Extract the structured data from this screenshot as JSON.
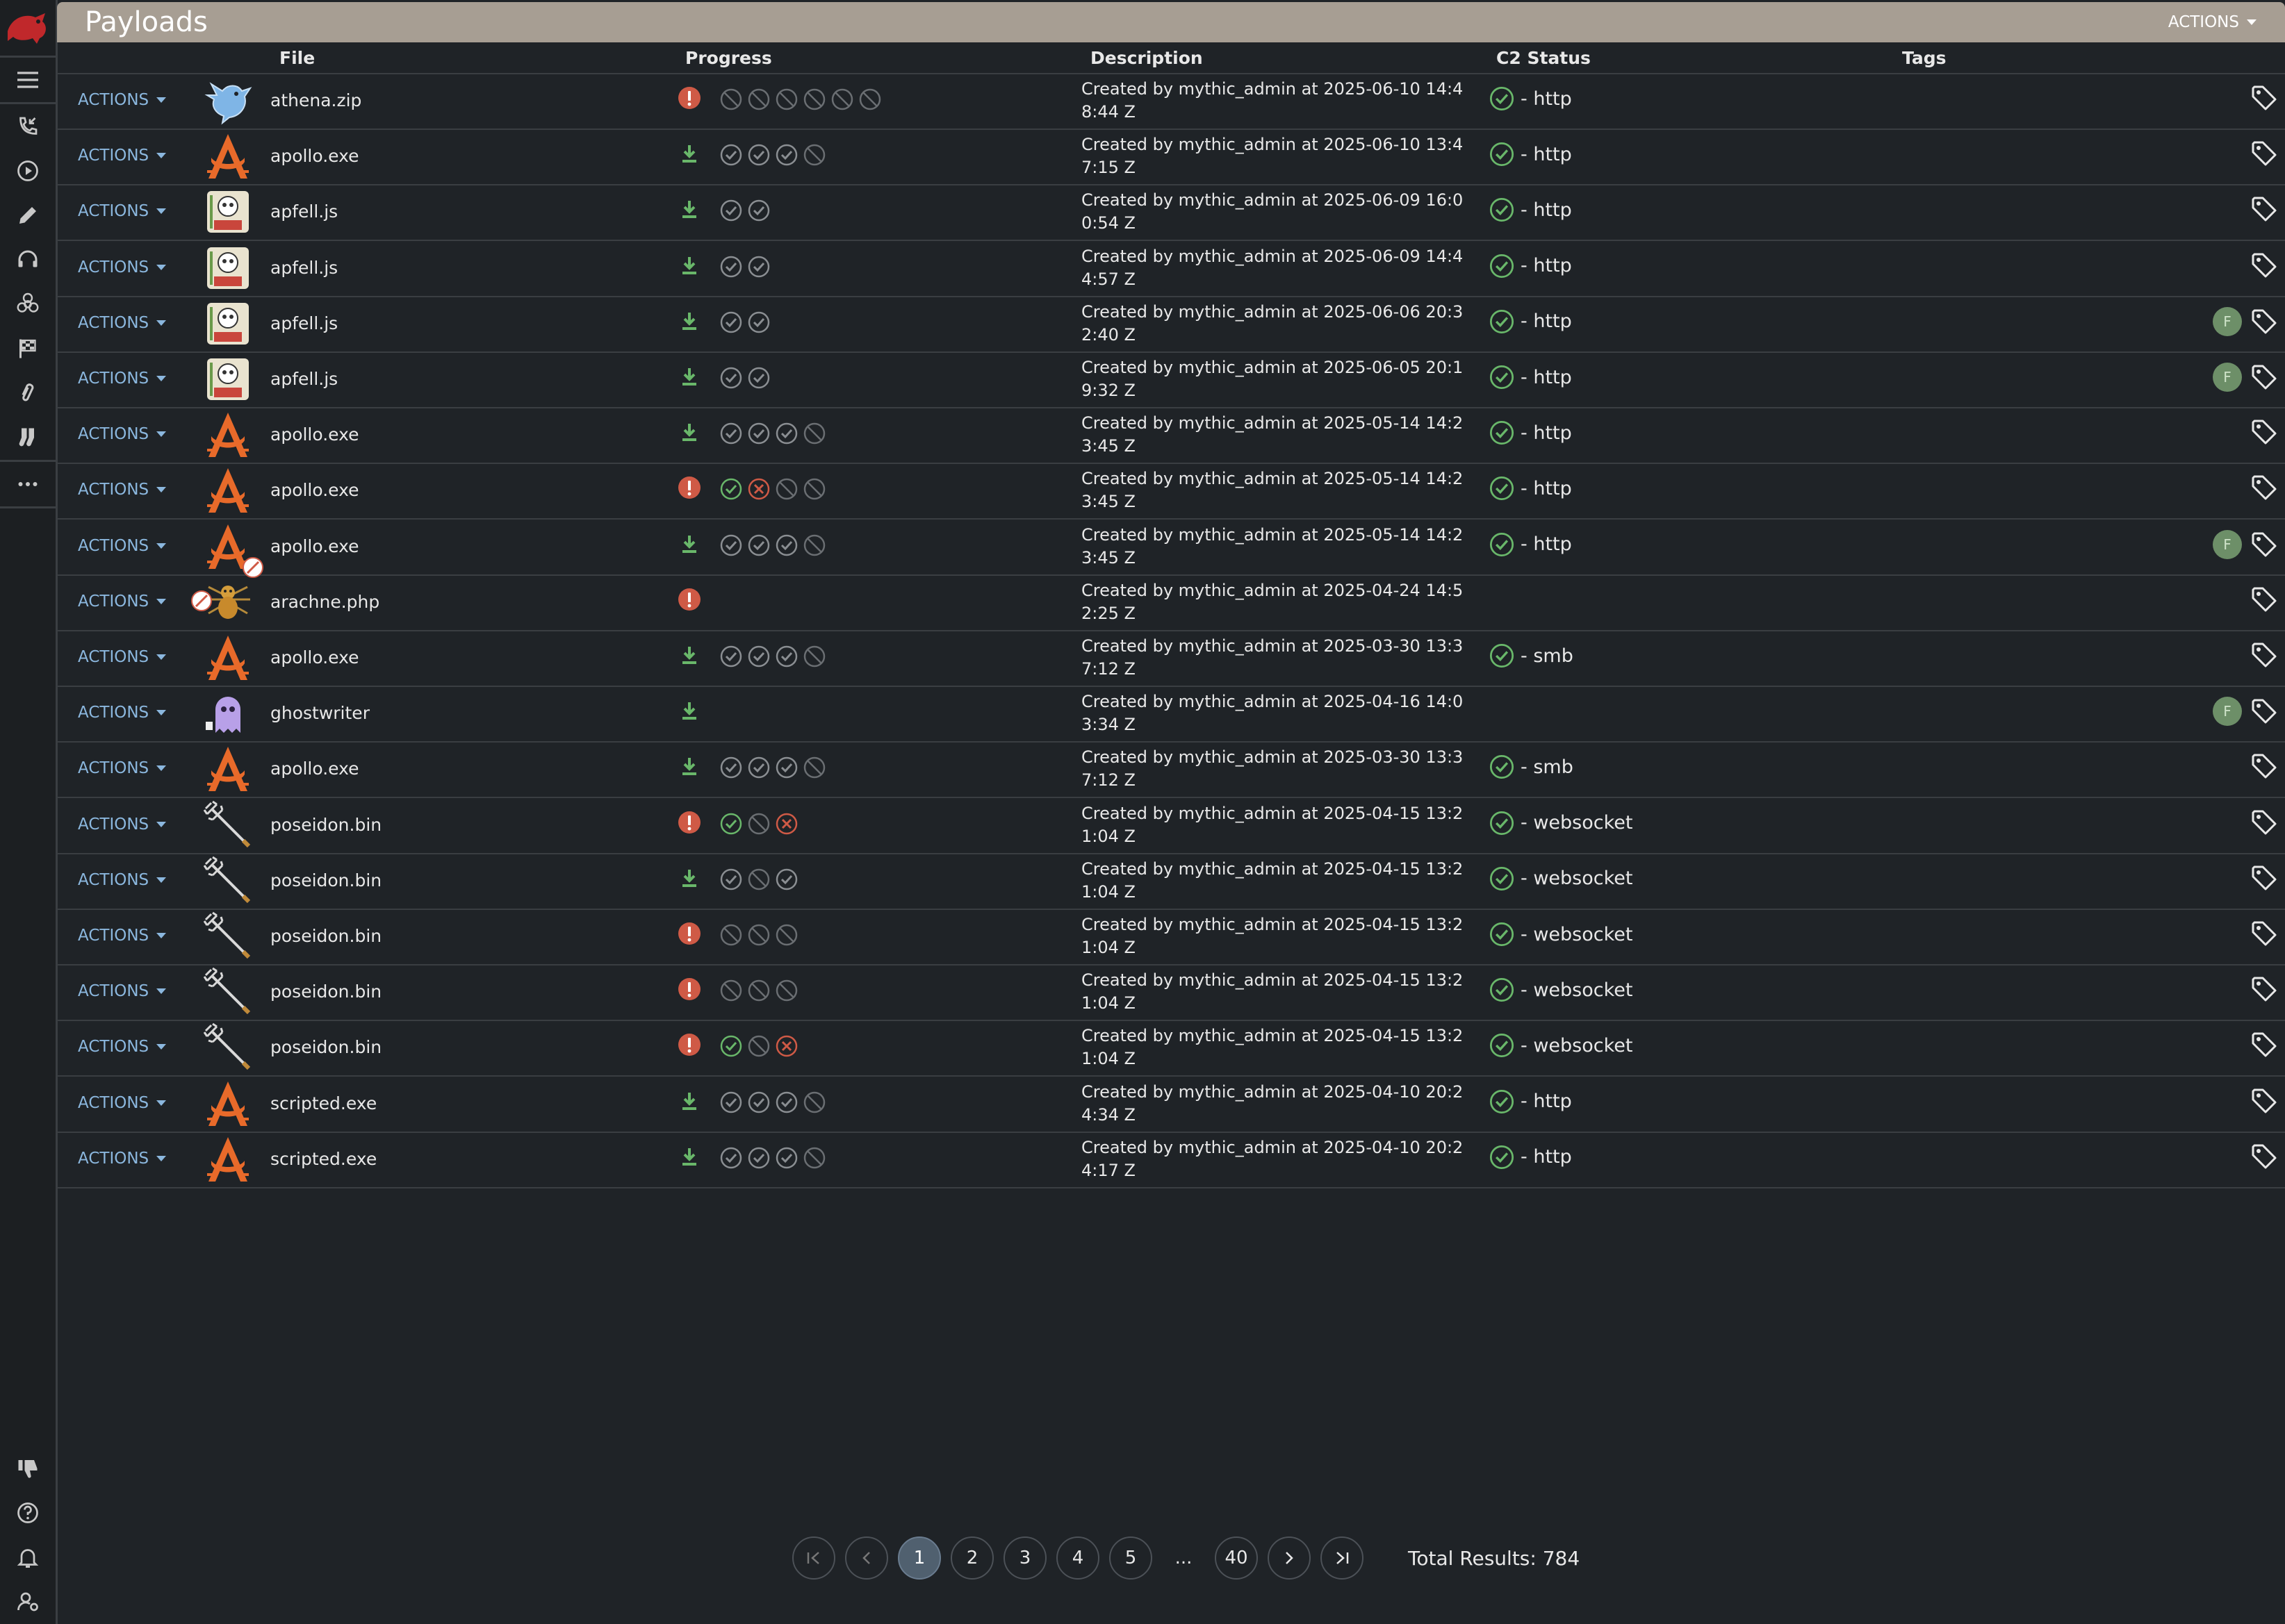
{
  "page": {
    "title": "Payloads",
    "actions_label": "ACTIONS"
  },
  "columns": {
    "file": "File",
    "progress": "Progress",
    "description": "Description",
    "c2": "C2 Status",
    "tags": "Tags"
  },
  "row_action_label": "ACTIONS",
  "sidebar": {
    "top_icons": [
      "phone-callback-icon",
      "play-circle-icon",
      "pencil-icon",
      "headset-icon",
      "biohazard-icon",
      "flag-checkered-icon",
      "paperclip-icon",
      "socks-icon",
      "more-icon"
    ],
    "bottom_icons": [
      "thumb-down-icon",
      "help-icon",
      "bell-alert-icon",
      "user-settings-icon"
    ]
  },
  "icon_types": {
    "athena": "blue-bird-icon",
    "apollo": "apollo-logo-icon",
    "apfell": "apfell-card-icon",
    "arachne": "spider-icon",
    "ghostwriter": "ghost-icon",
    "poseidon": "trident-icon"
  },
  "colors": {
    "success": "#69b76a",
    "error": "#cf5a46",
    "link": "#8bb7de",
    "titlebar": "#a79e93"
  },
  "rows": [
    {
      "file": "athena.zip",
      "icon": "athena",
      "status": "error",
      "steps": [
        "skip",
        "skip",
        "skip",
        "skip",
        "skip",
        "skip"
      ],
      "desc": "Created by mythic_admin at 2025-06-10 14:48:44 Z",
      "c2": "http",
      "tag": false
    },
    {
      "file": "apollo.exe",
      "icon": "apollo",
      "status": "download",
      "steps": [
        "done",
        "done",
        "done",
        "skip"
      ],
      "desc": "Created by mythic_admin at 2025-06-10 13:47:15 Z",
      "c2": "http",
      "tag": false
    },
    {
      "file": "apfell.js",
      "icon": "apfell",
      "status": "download",
      "steps": [
        "done",
        "done"
      ],
      "desc": "Created by mythic_admin at 2025-06-09 16:00:54 Z",
      "c2": "http",
      "tag": false
    },
    {
      "file": "apfell.js",
      "icon": "apfell",
      "status": "download",
      "steps": [
        "done",
        "done"
      ],
      "desc": "Created by mythic_admin at 2025-06-09 14:44:57 Z",
      "c2": "http",
      "tag": false
    },
    {
      "file": "apfell.js",
      "icon": "apfell",
      "status": "download",
      "steps": [
        "done",
        "done"
      ],
      "desc": "Created by mythic_admin at 2025-06-06 20:32:40 Z",
      "c2": "http",
      "tag": true
    },
    {
      "file": "apfell.js",
      "icon": "apfell",
      "status": "download",
      "steps": [
        "done",
        "done"
      ],
      "desc": "Created by mythic_admin at 2025-06-05 20:19:32 Z",
      "c2": "http",
      "tag": true
    },
    {
      "file": "apollo.exe",
      "icon": "apollo",
      "status": "download",
      "steps": [
        "done",
        "done",
        "done",
        "skip"
      ],
      "desc": "Created by mythic_admin at 2025-05-14 14:23:45 Z",
      "c2": "http",
      "tag": false
    },
    {
      "file": "apollo.exe",
      "icon": "apollo",
      "status": "error",
      "steps": [
        "ok",
        "fail",
        "skip",
        "skip"
      ],
      "desc": "Created by mythic_admin at 2025-05-14 14:23:45 Z",
      "c2": "http",
      "tag": false
    },
    {
      "file": "apollo.exe",
      "icon": "apollo",
      "status": "download",
      "steps": [
        "done",
        "done",
        "done",
        "skip"
      ],
      "desc": "Created by mythic_admin at 2025-05-14 14:23:45 Z",
      "c2": "http",
      "tag": true,
      "blocked": true
    },
    {
      "file": "arachne.php",
      "icon": "arachne",
      "status": "error",
      "steps": [],
      "desc": "Created by mythic_admin at 2025-04-24 14:52:25 Z",
      "c2": "",
      "tag": false,
      "blocked_left": true
    },
    {
      "file": "apollo.exe",
      "icon": "apollo",
      "status": "download",
      "steps": [
        "done",
        "done",
        "done",
        "skip"
      ],
      "desc": "Created by mythic_admin at 2025-03-30 13:37:12 Z",
      "c2": "smb",
      "tag": false
    },
    {
      "file": "ghostwriter",
      "icon": "ghostwriter",
      "status": "download",
      "steps": [],
      "desc": "Created by mythic_admin at 2025-04-16 14:03:34 Z",
      "c2": "",
      "tag": true
    },
    {
      "file": "apollo.exe",
      "icon": "apollo",
      "status": "download",
      "steps": [
        "done",
        "done",
        "done",
        "skip"
      ],
      "desc": "Created by mythic_admin at 2025-03-30 13:37:12 Z",
      "c2": "smb",
      "tag": false
    },
    {
      "file": "poseidon.bin",
      "icon": "poseidon",
      "status": "error",
      "steps": [
        "ok",
        "skip",
        "fail"
      ],
      "desc": "Created by mythic_admin at 2025-04-15 13:21:04 Z",
      "c2": "websocket",
      "tag": false
    },
    {
      "file": "poseidon.bin",
      "icon": "poseidon",
      "status": "download",
      "steps": [
        "done",
        "skip",
        "done"
      ],
      "desc": "Created by mythic_admin at 2025-04-15 13:21:04 Z",
      "c2": "websocket",
      "tag": false
    },
    {
      "file": "poseidon.bin",
      "icon": "poseidon",
      "status": "error",
      "steps": [
        "skip",
        "skip",
        "skip"
      ],
      "desc": "Created by mythic_admin at 2025-04-15 13:21:04 Z",
      "c2": "websocket",
      "tag": false
    },
    {
      "file": "poseidon.bin",
      "icon": "poseidon",
      "status": "error",
      "steps": [
        "skip",
        "skip",
        "skip"
      ],
      "desc": "Created by mythic_admin at 2025-04-15 13:21:04 Z",
      "c2": "websocket",
      "tag": false
    },
    {
      "file": "poseidon.bin",
      "icon": "poseidon",
      "status": "error",
      "steps": [
        "ok",
        "skip",
        "fail"
      ],
      "desc": "Created by mythic_admin at 2025-04-15 13:21:04 Z",
      "c2": "websocket",
      "tag": false
    },
    {
      "file": "scripted.exe",
      "icon": "apollo",
      "status": "download",
      "steps": [
        "done",
        "done",
        "done",
        "skip"
      ],
      "desc": "Created by mythic_admin at 2025-04-10 20:24:34 Z",
      "c2": "http",
      "tag": false
    },
    {
      "file": "scripted.exe",
      "icon": "apollo",
      "status": "download",
      "steps": [
        "done",
        "done",
        "done",
        "skip"
      ],
      "desc": "Created by mythic_admin at 2025-04-10 20:24:17 Z",
      "c2": "http",
      "tag": false
    }
  ],
  "tag_badge_letter": "F",
  "pagination": {
    "pages": [
      "1",
      "2",
      "3",
      "4",
      "5"
    ],
    "ellipsis": "...",
    "last": "40",
    "current": "1"
  },
  "total_results": "Total Results: 784"
}
